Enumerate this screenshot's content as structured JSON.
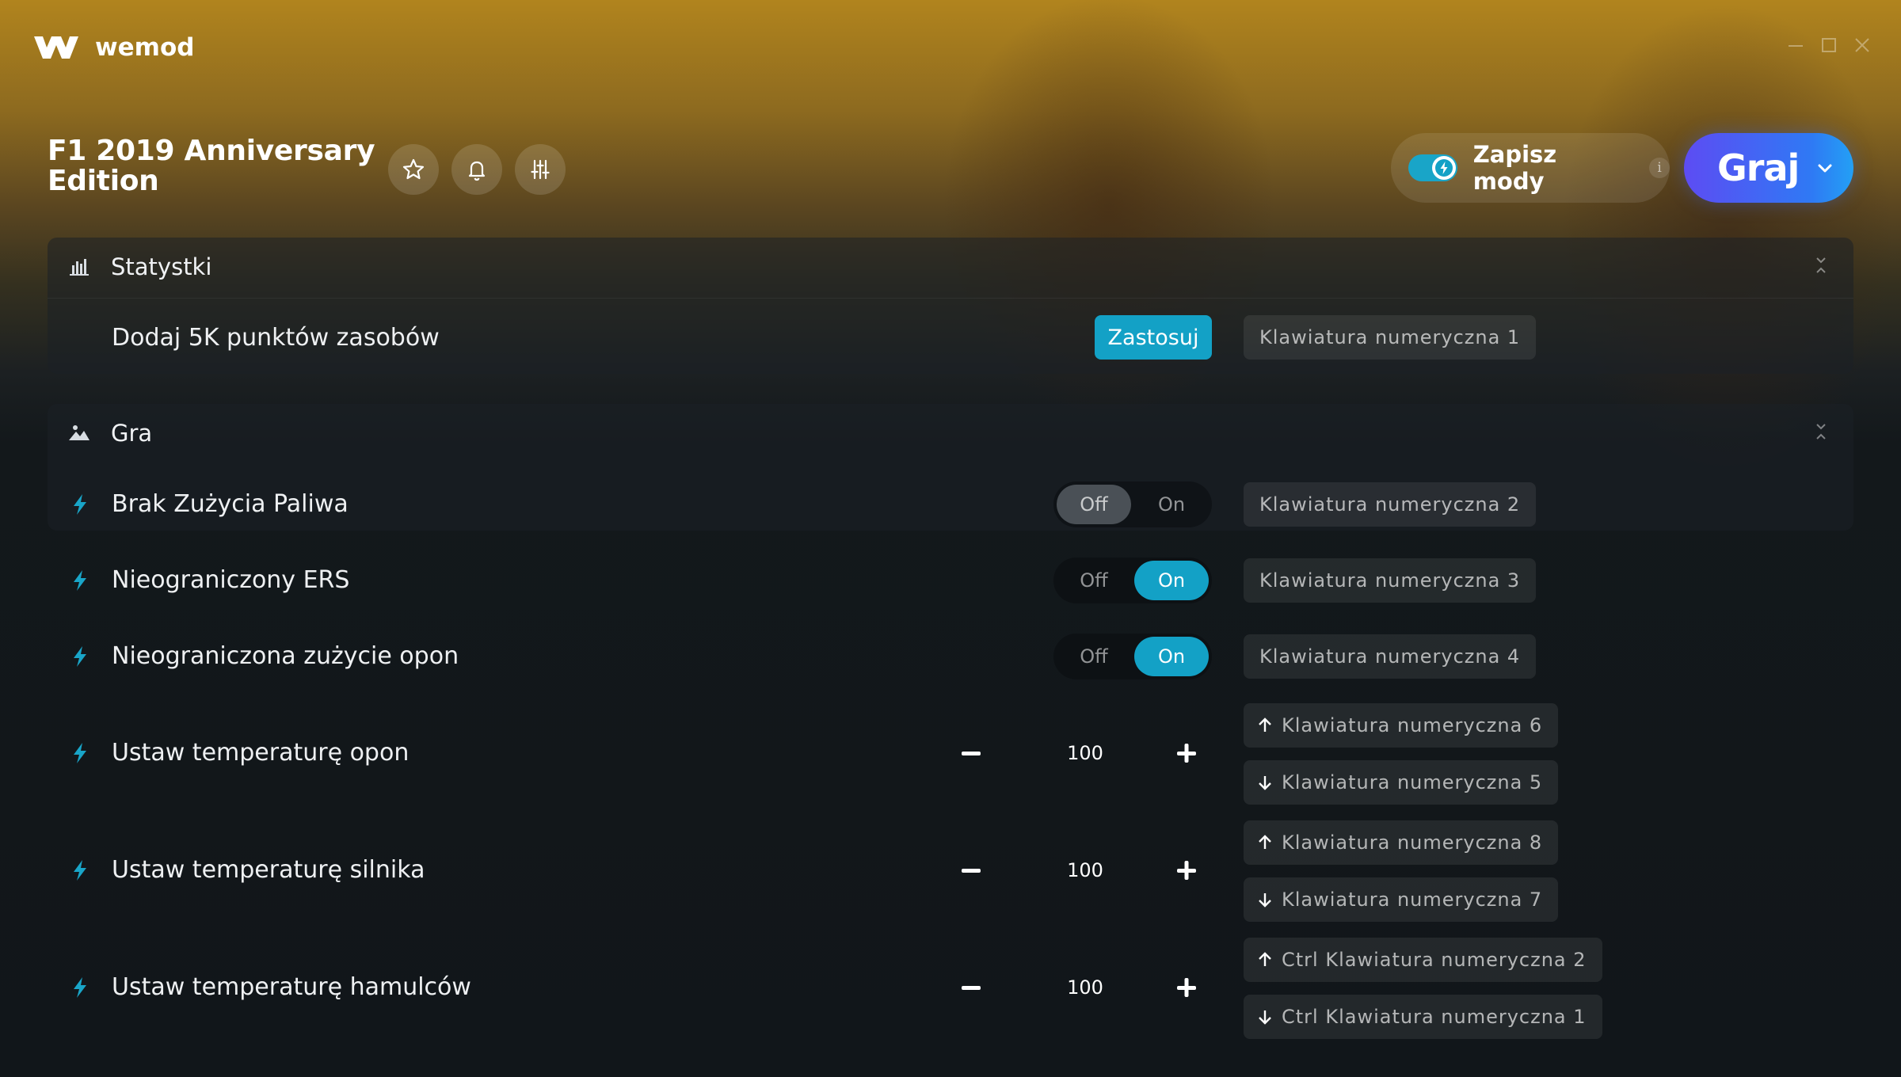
{
  "app": {
    "name": "wemod"
  },
  "header": {
    "game_title": "F1 2019 Anniversary Edition",
    "save_mods_label": "Zapisz mody",
    "info_label": "i",
    "play_label": "Graj"
  },
  "colors": {
    "accent": "#13a1c6",
    "play_start": "#5d4cf3",
    "play_end": "#23a0f5"
  },
  "sections": {
    "stats": {
      "title": "Statystki",
      "rows": [
        {
          "label": "Dodaj 5K punktów zasobów",
          "apply_label": "Zastosuj",
          "hotkey": "Klawiatura numeryczna 1"
        }
      ]
    },
    "game": {
      "title": "Gra",
      "toggles": [
        {
          "label": "Brak Zużycia Paliwa",
          "off": "Off",
          "on": "On",
          "state": "off",
          "hotkey": "Klawiatura numeryczna 2"
        },
        {
          "label": "Nieograniczony ERS",
          "off": "Off",
          "on": "On",
          "state": "on",
          "hotkey": "Klawiatura numeryczna 3"
        },
        {
          "label": "Nieograniczona zużycie opon",
          "off": "Off",
          "on": "On",
          "state": "on",
          "hotkey": "Klawiatura numeryczna 4"
        }
      ],
      "steppers": [
        {
          "label": "Ustaw temperaturę opon",
          "value": "100",
          "hotkey_up": "Klawiatura numeryczna 6",
          "hotkey_down": "Klawiatura numeryczna 5"
        },
        {
          "label": "Ustaw temperaturę silnika",
          "value": "100",
          "hotkey_up": "Klawiatura numeryczna 8",
          "hotkey_down": "Klawiatura numeryczna 7"
        },
        {
          "label": "Ustaw temperaturę hamulców",
          "value": "100",
          "hotkey_up": "Ctrl Klawiatura numeryczna 2",
          "hotkey_down": "Ctrl Klawiatura numeryczna 1"
        }
      ]
    }
  }
}
